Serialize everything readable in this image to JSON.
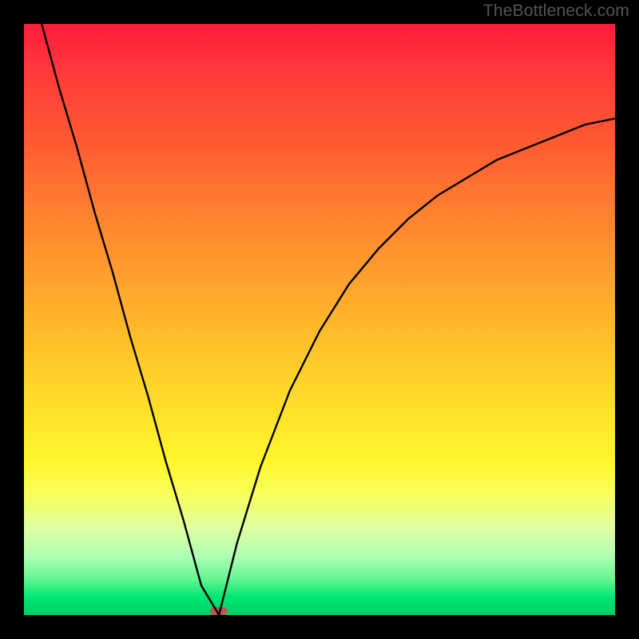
{
  "watermark": "TheBottleneck.com",
  "chart_data": {
    "type": "line",
    "title": "",
    "xlabel": "",
    "ylabel": "",
    "xlim": [
      0,
      100
    ],
    "ylim": [
      0,
      100
    ],
    "grid": false,
    "legend": false,
    "optimum_x": 33,
    "optimum_marker_color": "#c25752",
    "series": [
      {
        "name": "left-branch",
        "x": [
          3,
          6,
          9,
          12,
          15,
          18,
          21,
          24,
          27,
          30,
          33
        ],
        "values": [
          100,
          89,
          79,
          68,
          58,
          47,
          37,
          26,
          16,
          5,
          0
        ]
      },
      {
        "name": "right-branch",
        "x": [
          33,
          36,
          40,
          45,
          50,
          55,
          60,
          65,
          70,
          75,
          80,
          85,
          90,
          95,
          100
        ],
        "values": [
          0,
          12,
          25,
          38,
          48,
          56,
          62,
          67,
          71,
          74,
          77,
          79,
          81,
          83,
          84
        ]
      }
    ],
    "gradient_stops": [
      {
        "pos": 0,
        "color": "#ff1c3d"
      },
      {
        "pos": 20,
        "color": "#ff5a32"
      },
      {
        "pos": 44,
        "color": "#ffa32c"
      },
      {
        "pos": 66,
        "color": "#ffe22a"
      },
      {
        "pos": 80,
        "color": "#f7ff5e"
      },
      {
        "pos": 90,
        "color": "#b0ffb4"
      },
      {
        "pos": 100,
        "color": "#00d060"
      }
    ]
  }
}
